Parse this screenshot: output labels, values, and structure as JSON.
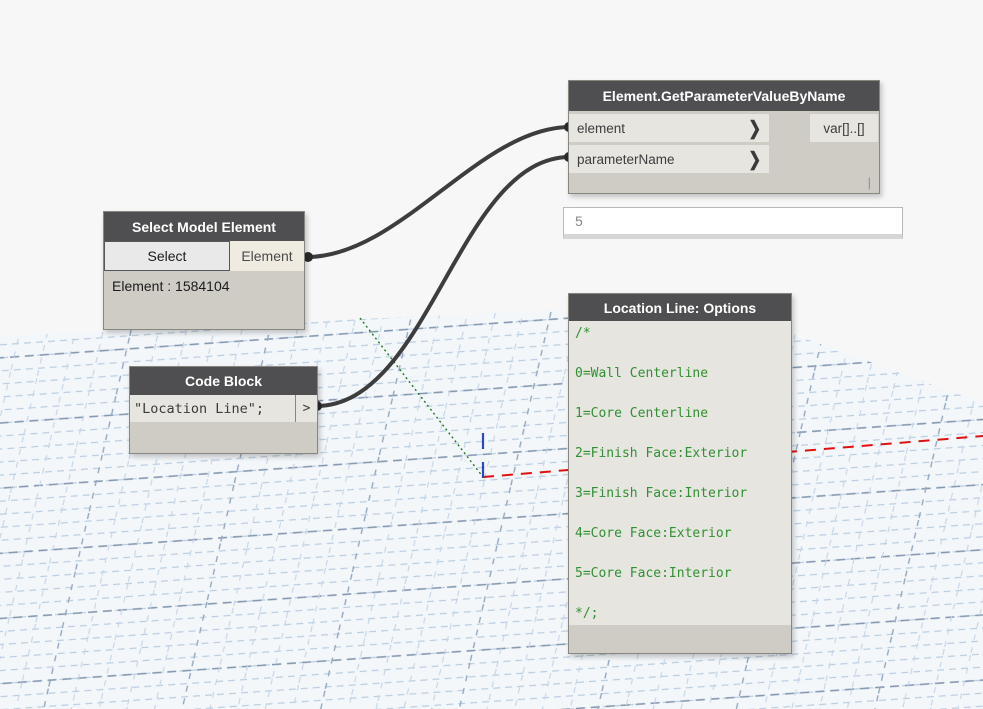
{
  "canvas": {
    "background_color": "#f7f7f7",
    "grid": {
      "minor_line_color": "#b9cde1",
      "major_line_color": "#8296ad",
      "axis_x_color": "#e01010",
      "axis_y_color": "#1e7a1e",
      "axis_z_color": "#2b47cc"
    },
    "wire_color": "#3d3d3d"
  },
  "nodes": {
    "get_parameter": {
      "title": "Element.GetParameterValueByName",
      "inputs": [
        {
          "label": "element"
        },
        {
          "label": "parameterName"
        }
      ],
      "output_label": "var[]..[]",
      "chevron": "❯",
      "resize_glyph": "|"
    },
    "preview_bubble": {
      "value": "5"
    },
    "select_model_element": {
      "title": "Select Model Element",
      "button_label": "Select",
      "output_label": "Element",
      "value_text": "Element : 1584104"
    },
    "code_block": {
      "title": "Code Block",
      "code": "\"Location Line\";",
      "output_glyph": ">"
    },
    "options": {
      "title": "Location Line: Options",
      "lines": [
        "/*",
        "",
        "0=Wall Centerline",
        "",
        "1=Core Centerline",
        "",
        "2=Finish Face:Exterior",
        "",
        "3=Finish Face:Interior",
        "",
        "4=Core Face:Exterior",
        "",
        "5=Core Face:Interior",
        "",
        "*/;"
      ]
    }
  }
}
